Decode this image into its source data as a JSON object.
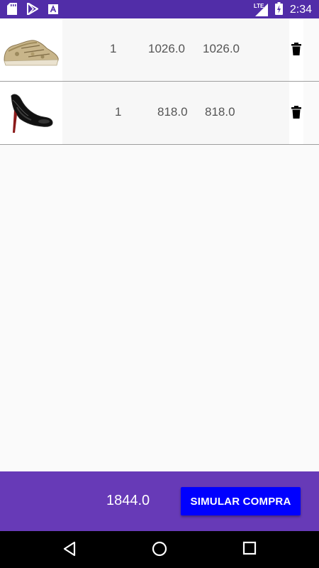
{
  "status_bar": {
    "time": "2:34",
    "network": "LTE",
    "icons": [
      "sd-card-icon",
      "play-store-icon",
      "a-notification-icon",
      "signal-icon",
      "battery-icon"
    ]
  },
  "cart": {
    "items": [
      {
        "image": "sneaker-image",
        "quantity": "1",
        "unit_price": "1026.0",
        "subtotal": "1026.0",
        "delete_icon": "trash-icon"
      },
      {
        "image": "heel-shoe-image",
        "quantity": "1",
        "unit_price": "818.0",
        "subtotal": "818.0",
        "delete_icon": "trash-icon"
      }
    ]
  },
  "footer": {
    "total": "1844.0",
    "button_label": "SIMULAR COMPRA"
  },
  "nav_bar": {
    "icons": [
      "back-icon",
      "home-icon",
      "recents-icon"
    ]
  },
  "colors": {
    "status_bar": "#512da8",
    "footer": "#673ab7",
    "button": "#0000ff"
  }
}
